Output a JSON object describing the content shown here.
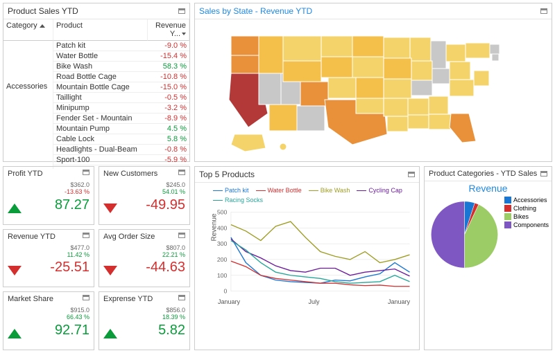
{
  "product_sales": {
    "title": "Product Sales YTD",
    "headers": {
      "category": "Category",
      "product": "Product",
      "revenue": "Revenue Y..."
    },
    "category": "Accessories",
    "rows": [
      {
        "product": "Patch kit",
        "value": "-9.0 %",
        "neg": true
      },
      {
        "product": "Water Bottle",
        "value": "-15.4 %",
        "neg": true
      },
      {
        "product": "Bike Wash",
        "value": "58.3 %",
        "neg": false
      },
      {
        "product": "Road Bottle Cage",
        "value": "-10.8 %",
        "neg": true
      },
      {
        "product": "Mountain Bottle Cage",
        "value": "-15.0 %",
        "neg": true
      },
      {
        "product": "Taillight",
        "value": "-0.5 %",
        "neg": true
      },
      {
        "product": "Minipump",
        "value": "-3.2 %",
        "neg": true
      },
      {
        "product": "Fender Set - Mountain",
        "value": "-8.9 %",
        "neg": true
      },
      {
        "product": "Mountain Pump",
        "value": "4.5 %",
        "neg": false
      },
      {
        "product": "Cable Lock",
        "value": "5.8 %",
        "neg": false
      },
      {
        "product": "Headlights - Dual-Beam",
        "value": "-0.8 %",
        "neg": true
      },
      {
        "product": "Sport-100",
        "value": "-5.9 %",
        "neg": true
      }
    ]
  },
  "kpis": [
    {
      "title": "Profit YTD",
      "sub1": "$362.0",
      "sub2": "-13.63 %",
      "subneg": true,
      "value": "87.27",
      "up": true
    },
    {
      "title": "New Customers",
      "sub1": "$245.0",
      "sub2": "54.01 %",
      "subneg": false,
      "value": "-49.95",
      "up": false
    },
    {
      "title": "Revenue YTD",
      "sub1": "$477.0",
      "sub2": "11.42 %",
      "subneg": false,
      "value": "-25.51",
      "up": false
    },
    {
      "title": "Avg Order Size",
      "sub1": "$807.0",
      "sub2": "22.21 %",
      "subneg": false,
      "value": "-44.63",
      "up": false
    },
    {
      "title": "Market Share",
      "sub1": "$915.0",
      "sub2": "66.43 %",
      "subneg": false,
      "value": "92.71",
      "up": true
    },
    {
      "title": "Exprense YTD",
      "sub1": "$856.0",
      "sub2": "18.39 %",
      "subneg": false,
      "value": "5.82",
      "up": true
    }
  ],
  "map": {
    "title": "Sales by State - Revenue YTD"
  },
  "top5": {
    "title": "Top 5 Products",
    "ylabel": "Revenue",
    "xlabels": [
      "January",
      "July",
      "January"
    ],
    "series": [
      "Patch kit",
      "Water Bottle",
      "Bike Wash",
      "Cycling Cap",
      "Racing Socks"
    ]
  },
  "pie": {
    "title": "Product Categories - YTD Sales",
    "chart_title": "Revenue",
    "legend": [
      "Accessories",
      "Clothing",
      "Bikes",
      "Components"
    ]
  },
  "chart_data": {
    "top5_products": {
      "type": "line",
      "title": "Top 5 Products",
      "ylabel": "Revenue",
      "ylim": [
        0,
        500
      ],
      "x_ticks": [
        "January",
        "July",
        "January"
      ],
      "series": [
        {
          "name": "Patch kit",
          "color": "#1976d2",
          "values": [
            340,
            180,
            100,
            70,
            60,
            55,
            50,
            70,
            65,
            90,
            110,
            180,
            120
          ]
        },
        {
          "name": "Water Bottle",
          "color": "#d32f2f",
          "values": [
            190,
            155,
            100,
            80,
            70,
            60,
            50,
            50,
            40,
            35,
            38,
            30,
            30
          ]
        },
        {
          "name": "Bike Wash",
          "color": "#9e9d24",
          "values": [
            420,
            380,
            320,
            410,
            440,
            340,
            250,
            220,
            200,
            250,
            180,
            200,
            230
          ]
        },
        {
          "name": "Cycling Cap",
          "color": "#6a1b9a",
          "values": [
            330,
            250,
            210,
            160,
            130,
            120,
            145,
            145,
            100,
            120,
            130,
            140,
            95
          ]
        },
        {
          "name": "Racing Socks",
          "color": "#26a69a",
          "values": [
            320,
            260,
            180,
            120,
            100,
            90,
            80,
            60,
            50,
            55,
            60,
            100,
            60
          ]
        }
      ]
    },
    "category_pie": {
      "type": "pie",
      "title": "Revenue",
      "slices": [
        {
          "name": "Accessories",
          "value": 5,
          "color": "#1976d2"
        },
        {
          "name": "Clothing",
          "value": 2,
          "color": "#d32f2f"
        },
        {
          "name": "Bikes",
          "value": 43,
          "color": "#9ccc65"
        },
        {
          "name": "Components",
          "value": 50,
          "color": "#7e57c2"
        }
      ]
    },
    "map": {
      "type": "choropleth",
      "title": "Sales by State - Revenue YTD",
      "note": "US states colored by revenue; CA selected (dark red, black outline); OR/TX/CO deep orange; most plains/southeast yellow; NV/UT/NM/WV/VT/NH/ME/MI/KY gray (no data)."
    }
  }
}
